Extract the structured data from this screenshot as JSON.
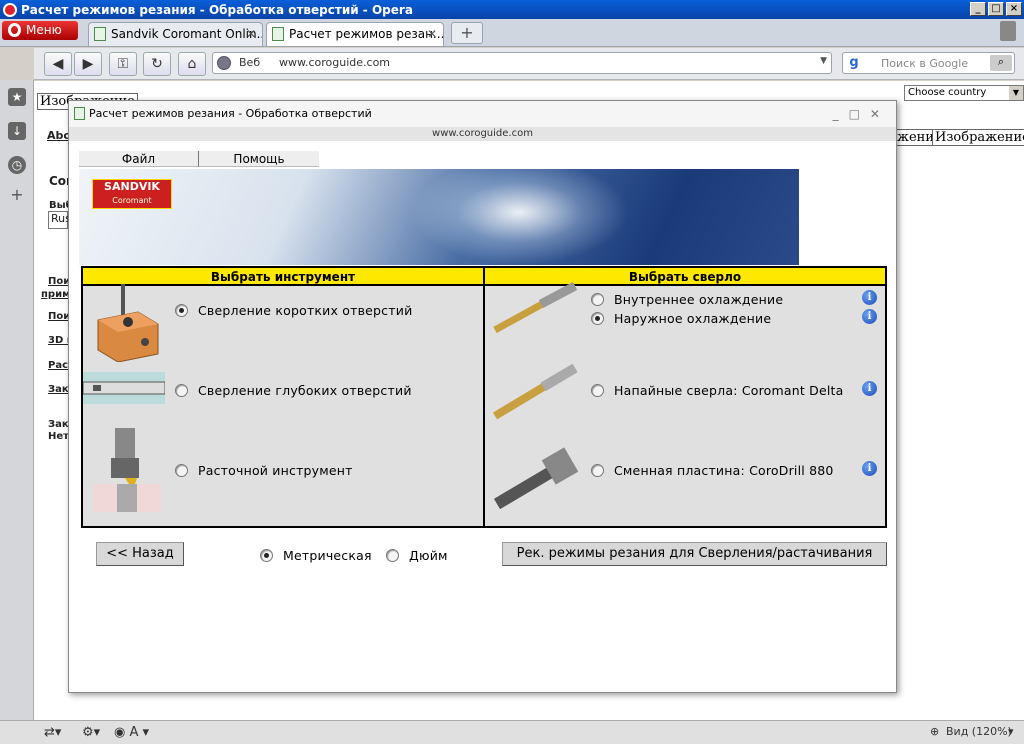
{
  "window": {
    "title": "Расчет режимов резания - Обработка отверстий - Opera"
  },
  "browser": {
    "menu_label": "Меню",
    "tabs": [
      {
        "label": "Sandvik Coromant Onlin..."
      },
      {
        "label": "Расчет режимов резан..."
      }
    ],
    "address": {
      "scope": "Веб",
      "url": "www.coroguide.com"
    },
    "search_placeholder": "Поиск в Google",
    "zoom_label": "Вид (120%)"
  },
  "background_page": {
    "top_tab": "Изображение",
    "country_select": "Choose country",
    "right_tabs": [
      "жение",
      "Изображение"
    ],
    "side_texts": [
      "Abc",
      "Cor",
      "Выб",
      "Rus",
      "Пои",
      "прим",
      "Пои",
      "3D м",
      "Рас",
      "Зак",
      "Зак",
      "Нет"
    ]
  },
  "popup": {
    "title": "Расчет режимов резания - Обработка отверстий",
    "url": "www.coroguide.com",
    "menu": [
      "Файл",
      "Помощь"
    ],
    "logo": {
      "line1": "SANDVIK",
      "line2": "Coromant"
    },
    "left_header": "Выбрать инструмент",
    "right_header": "Выбрать сверло",
    "tools": [
      {
        "label": "Сверление коротких отверстий",
        "selected": true
      },
      {
        "label": "Сверление глубоких отверстий",
        "selected": false
      },
      {
        "label": "Расточной инструмент",
        "selected": false
      }
    ],
    "drills": [
      {
        "label": "Внутреннее охлаждение",
        "selected": false
      },
      {
        "label": "Наружное охлаждение",
        "selected": true
      },
      {
        "label": "Напайные сверла: Coromant Delta",
        "selected": false
      },
      {
        "label": "Сменная пластина: CoroDrill 880",
        "selected": false
      }
    ],
    "back_button": "<< Назад",
    "units": [
      {
        "label": "Метрическая",
        "selected": true
      },
      {
        "label": "Дюйм",
        "selected": false
      }
    ],
    "recommend_button": "Рек. режимы резания для Сверления/растачивания"
  },
  "colors": {
    "header_yellow": "#ffe800",
    "title_blue": "#0a5fd8",
    "logo_red": "#cc2020"
  }
}
